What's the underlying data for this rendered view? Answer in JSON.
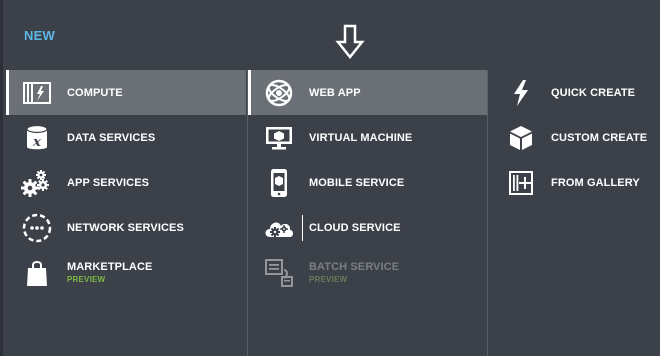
{
  "header": {
    "title": "NEW"
  },
  "categories": [
    {
      "label": "COMPUTE",
      "icon": "compute-icon",
      "selected": true
    },
    {
      "label": "DATA SERVICES",
      "icon": "database-icon"
    },
    {
      "label": "APP SERVICES",
      "icon": "gears-icon"
    },
    {
      "label": "NETWORK SERVICES",
      "icon": "network-icon"
    },
    {
      "label": "MARKETPLACE",
      "sub": "PREVIEW",
      "icon": "shopping-bag-icon"
    }
  ],
  "compute_items": [
    {
      "label": "WEB APP",
      "icon": "globe-icon",
      "selected": true
    },
    {
      "label": "VIRTUAL MACHINE",
      "icon": "monitor-icon"
    },
    {
      "label": "MOBILE SERVICE",
      "icon": "mobile-icon"
    },
    {
      "label": "CLOUD SERVICE",
      "icon": "cloud-gear-icon"
    },
    {
      "label": "BATCH SERVICE",
      "sub": "PREVIEW",
      "icon": "batch-icon",
      "disabled": true
    }
  ],
  "create_options": [
    {
      "label": "QUICK CREATE",
      "icon": "lightning-icon"
    },
    {
      "label": "CUSTOM CREATE",
      "icon": "box-icon"
    },
    {
      "label": "FROM GALLERY",
      "icon": "gallery-plus-icon"
    }
  ],
  "colors": {
    "background": "#3c4049",
    "selected": "#6b6f76",
    "header_accent": "#5db7e6",
    "preview_green": "#7bb843"
  }
}
